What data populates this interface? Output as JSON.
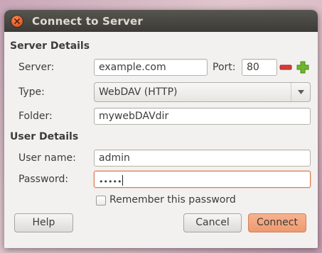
{
  "window": {
    "title": "Connect to Server"
  },
  "server_section": {
    "heading": "Server Details",
    "server_label": "Server:",
    "server_value": "example.com",
    "port_label": "Port:",
    "port_value": "80",
    "type_label": "Type:",
    "type_value": "WebDAV (HTTP)",
    "folder_label": "Folder:",
    "folder_value": "mywebDAVdir"
  },
  "user_section": {
    "heading": "User Details",
    "username_label": "User name:",
    "username_value": "admin",
    "password_label": "Password:",
    "password_value": "•••••",
    "remember_label": "Remember this password",
    "remember_checked": false
  },
  "buttons": {
    "help": "Help",
    "cancel": "Cancel",
    "connect": "Connect"
  },
  "colors": {
    "accent": "#ee9a6f",
    "titlebar": "#3c3b37",
    "close": "#e55e28",
    "minus": "#d83a3a",
    "plus": "#6fb52c"
  },
  "icons": {
    "close": "close-icon",
    "decrement": "minus-icon",
    "increment": "plus-icon",
    "dropdown": "chevron-down-icon"
  }
}
